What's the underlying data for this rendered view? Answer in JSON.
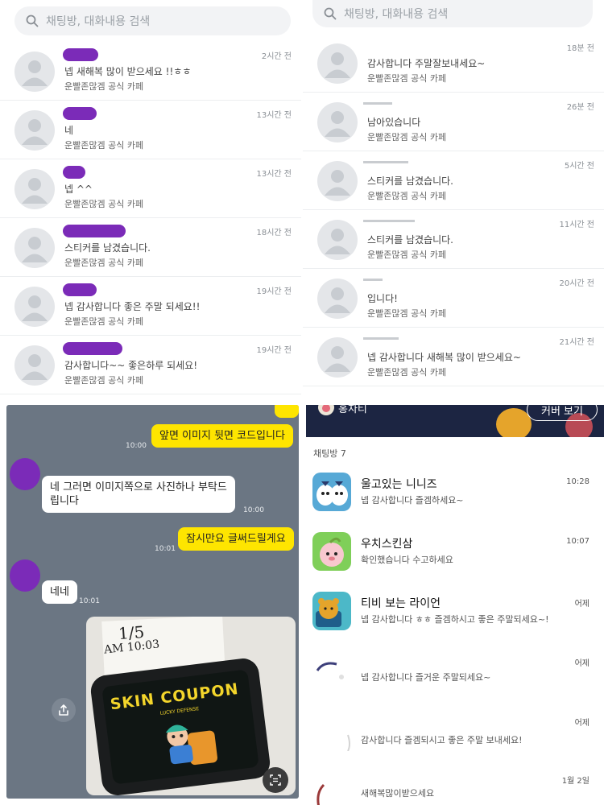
{
  "top_left": {
    "search_placeholder": "채팅방, 대화내용 검색",
    "items": [
      {
        "message": "넵 새해복 많이 받으세요 !!ㅎㅎ",
        "cafe": "운빨존많겜 공식 카페",
        "time": "2시간 전"
      },
      {
        "message": "네",
        "cafe": "운빨존많겜 공식 카페",
        "time": "13시간 전"
      },
      {
        "message": "넵 ^^",
        "cafe": "운빨존많겜 공식 카페",
        "time": "13시간 전"
      },
      {
        "message": "스티커를 남겼습니다.",
        "cafe": "운빨존많겜 공식 카페",
        "time": "18시간 전"
      },
      {
        "message": "넵 감사합니다 좋은 주말 되세요!!",
        "cafe": "운빨존많겜 공식 카페",
        "time": "19시간 전"
      },
      {
        "message": "감사합니다~~ 좋은하루 되세요!",
        "cafe": "운빨존많겜 공식 카페",
        "time": "19시간 전"
      }
    ]
  },
  "top_right": {
    "search_placeholder": "채팅방, 대화내용 검색",
    "items": [
      {
        "message": "감사합니다 주말잘보내세요~",
        "cafe": "운빨존많겜 공식 카페",
        "time": "18분 전"
      },
      {
        "message": "남아있습니다",
        "cafe": "운빨존많겜 공식 카페",
        "time": "26분 전"
      },
      {
        "message": "스티커를 남겼습니다.",
        "cafe": "운빨존많겜 공식 카페",
        "time": "5시간 전"
      },
      {
        "message": "스티커를 남겼습니다.",
        "cafe": "운빨존많겜 공식 카페",
        "time": "11시간 전"
      },
      {
        "message": "입니다!",
        "cafe": "운빨존많겜 공식 카페",
        "time": "20시간 전"
      },
      {
        "message": "넵 감사합니다 새해복 많이 받으세요~",
        "cafe": "운빨존많겜 공식 카페",
        "time": "21시간 전"
      }
    ]
  },
  "chat": {
    "messages": [
      {
        "from": "me",
        "text": "앞면 이미지 뒷면 코드입니다",
        "time": "10:00"
      },
      {
        "from": "them",
        "text_line1": "네 그러면 이미지쪽으로 사진하나 부탁드",
        "text_line2": "립니다",
        "time": "10:00"
      },
      {
        "from": "me",
        "text": "잠시만요 글써드릴게요",
        "time": "10:01"
      },
      {
        "from": "them",
        "text": "네네",
        "time": "10:01"
      }
    ],
    "photo": {
      "handwriting_line1": "1/5",
      "handwriting_line2": "AM 10:03",
      "coupon_text": "SKIN COUPON",
      "coupon_subtext": "LUCKY DEFENSE"
    },
    "share_icon": "share-icon",
    "scan_icon": "scan-icon"
  },
  "bottom_right": {
    "banner_title": "홍차티",
    "banner_button": "커버 보기",
    "rooms_label": "채팅방 7",
    "rooms": [
      {
        "name": "울고있는 니니즈",
        "message": "넵 감사합니다 즐겜하세요~",
        "time": "10:28"
      },
      {
        "name": "우치스킨삼",
        "message": "확인했습니다 수고하세요",
        "time": "10:07"
      },
      {
        "name": "티비 보는 라이언",
        "message": "넵 감사합니다 ㅎㅎ 즐겜하시고 좋은 주말되세요~!",
        "time": "어제"
      },
      {
        "name": "",
        "message": "넵 감사합니다 즐거운 주말되세요~",
        "time": "어제"
      },
      {
        "name": "",
        "message": "감사합니다 즐겜되시고 좋은 주말 보내세요!",
        "time": "어제"
      },
      {
        "name": "",
        "message": "새해복많이받으세요",
        "time": "1월 2일"
      }
    ]
  },
  "colors": {
    "redaction": "#7b2bb8",
    "kakao_yellow": "#fee500",
    "chat_bg": "#6b7683"
  }
}
